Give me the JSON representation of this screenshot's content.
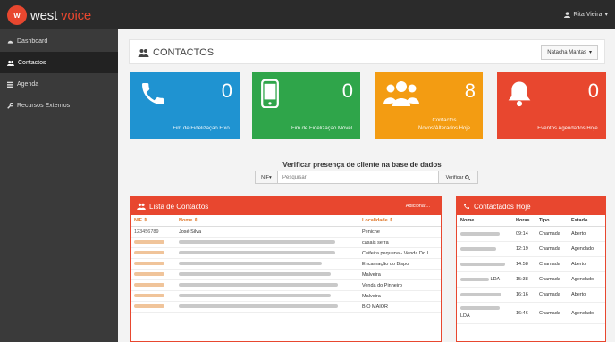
{
  "brand": {
    "badge": "w",
    "name_west": "west",
    "name_voice": "voice"
  },
  "user": {
    "name": "Rita Vieira"
  },
  "sidebar": {
    "items": [
      {
        "label": "Dashboard",
        "icon": "dashboard-icon"
      },
      {
        "label": "Contactos",
        "icon": "users-icon"
      },
      {
        "label": "Agenda",
        "icon": "list-icon"
      },
      {
        "label": "Recursos Externos",
        "icon": "wrench-icon"
      }
    ]
  },
  "page": {
    "title": "CONTACTOS",
    "user_select": "Natacha Mantas"
  },
  "tiles": [
    {
      "value": "0",
      "label": "Fim de Fidelização Fixo",
      "color": "#1f93d1",
      "icon": "phone-icon"
    },
    {
      "value": "0",
      "label": "Fim de Fidelização Móvel",
      "color": "#2fa54a",
      "icon": "mobile-icon"
    },
    {
      "value": "8",
      "label": "Contactos Novos/Alterados Hoje",
      "color": "#f39c12",
      "icon": "group-icon"
    },
    {
      "value": "0",
      "label": "Eventos Agendados Hoje",
      "color": "#e8472f",
      "icon": "bell-icon"
    }
  ],
  "search": {
    "title": "Verificar presença de cliente na base de dados",
    "type_label": "NIF",
    "placeholder": "Pesquisar",
    "button_label": "Verificar"
  },
  "contacts": {
    "title": "Lista de Contactos",
    "add_label": "Adicionar...",
    "columns": [
      "NIF",
      "Nome",
      "Localidade"
    ],
    "rows": [
      {
        "nif": "123456789",
        "nome": "José Silva",
        "localidade": "Peniche"
      },
      {
        "nif": "",
        "nome": "",
        "localidade": "casais serra"
      },
      {
        "nif": "",
        "nome": "",
        "localidade": "Ceifeira pequena - Venda Do I"
      },
      {
        "nif": "",
        "nome": "",
        "localidade": "Encarnação do Bispo"
      },
      {
        "nif": "",
        "nome": "",
        "localidade": "Malveira"
      },
      {
        "nif": "",
        "nome": "",
        "localidade": "Venda do Pinheiro"
      },
      {
        "nif": "",
        "nome": "",
        "localidade": "Malveira"
      },
      {
        "nif": "",
        "nome": "",
        "localidade": "BIO MAIOR"
      }
    ]
  },
  "today": {
    "title": "Contactados Hoje",
    "columns": [
      "Nome",
      "Horas",
      "Tipo",
      "Estado"
    ],
    "rows": [
      {
        "nome": "",
        "horas": "09:14",
        "tipo": "Chamada",
        "estado": "Aberto"
      },
      {
        "nome": "",
        "horas": "12:19",
        "tipo": "Chamada",
        "estado": "Agendado"
      },
      {
        "nome": "",
        "horas": "14:58",
        "tipo": "Chamada",
        "estado": "Aberto"
      },
      {
        "nome": "LDA",
        "horas": "15:38",
        "tipo": "Chamada",
        "estado": "Agendado"
      },
      {
        "nome": "",
        "horas": "16:16",
        "tipo": "Chamada",
        "estado": "Aberto"
      },
      {
        "nome": "LDA",
        "horas": "16:46",
        "tipo": "Chamada",
        "estado": "Agendado"
      }
    ]
  }
}
